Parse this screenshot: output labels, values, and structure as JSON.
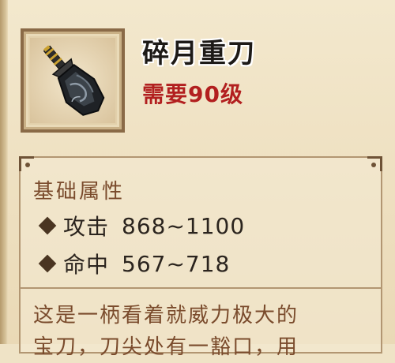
{
  "item": {
    "name": "碎月重刀",
    "requirement": "需要90级",
    "icon": "heavy-blade-icon"
  },
  "attributes": {
    "title": "基础属性",
    "stats": [
      {
        "label": "攻击",
        "value": "868~1100"
      },
      {
        "label": "命中",
        "value": "567~718"
      }
    ]
  },
  "description": {
    "line1": "这是一柄看着就威力极大的",
    "line2": "宝刀，刀尖处有一豁口，用"
  },
  "colors": {
    "requirement": "#b21f1f",
    "section_title": "#7a4b2c",
    "panel": "#efe3c6"
  }
}
